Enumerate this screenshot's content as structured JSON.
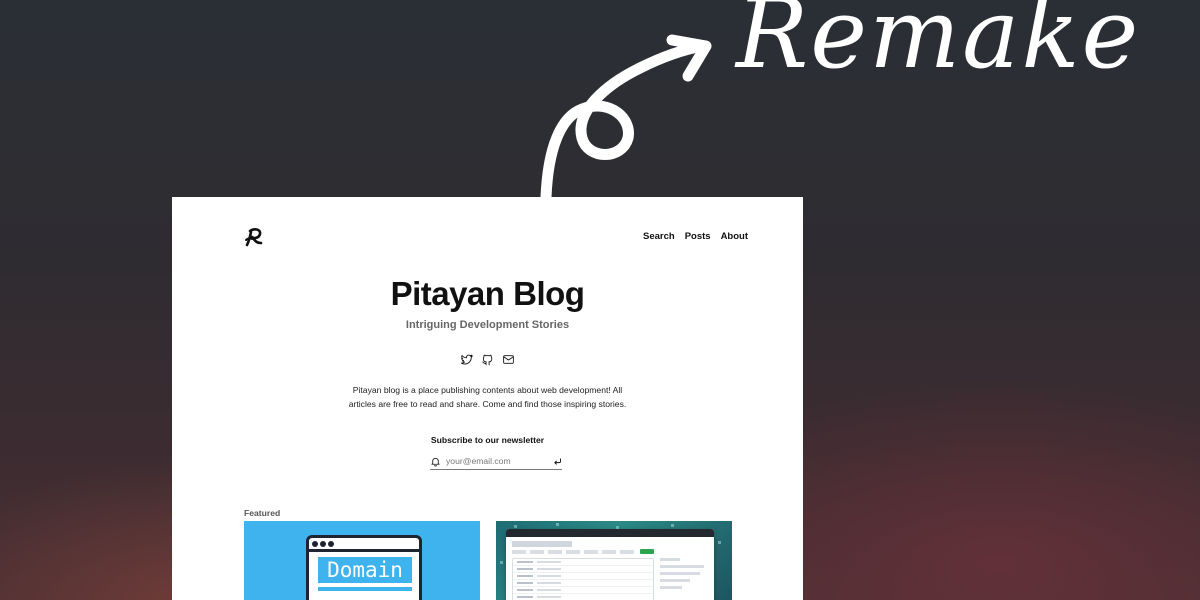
{
  "overlay": {
    "remake_label": "Remake"
  },
  "header": {
    "logo_icon": "pitayan-logo-icon",
    "nav": [
      {
        "label": "Search"
      },
      {
        "label": "Posts"
      },
      {
        "label": "About"
      }
    ]
  },
  "hero": {
    "title": "Pitayan Blog",
    "subtitle": "Intriguing Development Stories",
    "social_icons": [
      "twitter-icon",
      "github-icon",
      "mail-icon"
    ],
    "description": "Pitayan blog is a place publishing contents about web development! All articles are free to read and share. Come and find those inspiring stories."
  },
  "newsletter": {
    "label": "Subscribe to our newsletter",
    "placeholder": "your@email.com",
    "value": ""
  },
  "featured": {
    "label": "Featured",
    "cards": [
      {
        "image_text": "Domain",
        "background": "#3fb3ee"
      },
      {
        "image_text": "",
        "background": "#1e6b74"
      }
    ]
  },
  "colors": {
    "accent_blue": "#3fb3ee",
    "card_bg": "#ffffff",
    "text_dark": "#111111",
    "text_muted": "#666666"
  }
}
